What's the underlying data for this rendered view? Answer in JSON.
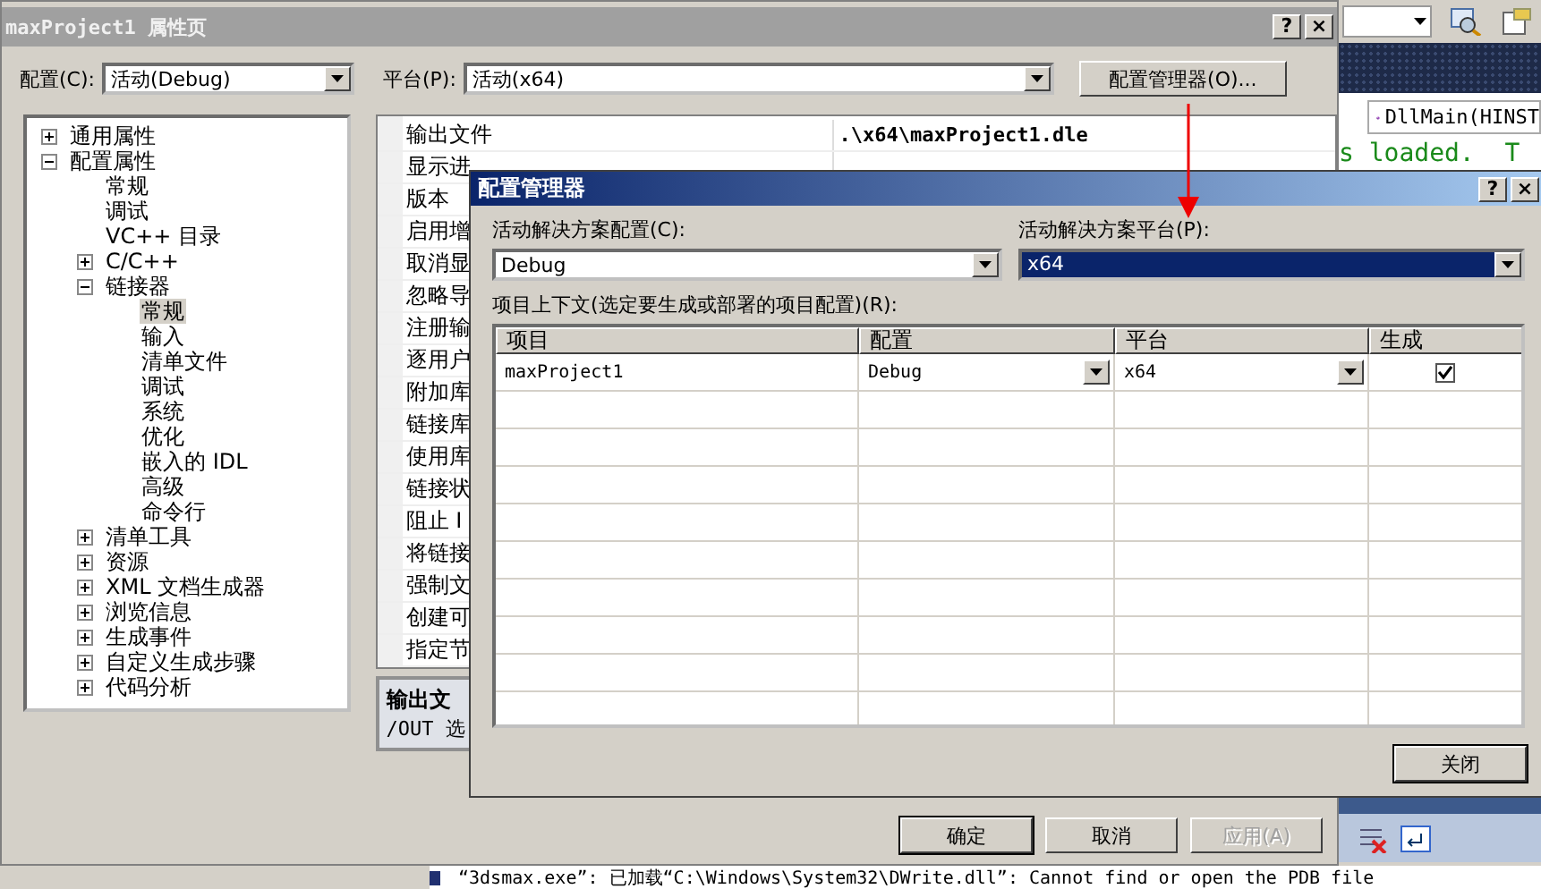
{
  "ide": {
    "function_combo": "DllMain(HINST",
    "code_snippet": "s loaded.  T",
    "output_line": "“3dsmax.exe”: 已加载“C:\\Windows\\System32\\DWrite.dll”: Cannot find or open the PDB file"
  },
  "property_window": {
    "title": "maxProject1 属性页",
    "help": "?",
    "close": "×",
    "config_label": "配置(C):",
    "config_value": "活动(Debug)",
    "platform_label": "平台(P):",
    "platform_value": "活动(x64)",
    "manager_button": "配置管理器(O)...",
    "tree": [
      {
        "label": "通用属性",
        "expanded": false,
        "selected": false
      },
      {
        "label": "配置属性",
        "expanded": true,
        "selected": false,
        "children": [
          {
            "label": "常规",
            "selected": false
          },
          {
            "label": "调试",
            "selected": false
          },
          {
            "label": "VC++ 目录",
            "selected": false
          },
          {
            "label": "C/C++",
            "expanded": false,
            "selected": false
          },
          {
            "label": "链接器",
            "expanded": true,
            "selected": false,
            "children": [
              {
                "label": "常规",
                "selected": true
              },
              {
                "label": "输入",
                "selected": false
              },
              {
                "label": "清单文件",
                "selected": false
              },
              {
                "label": "调试",
                "selected": false
              },
              {
                "label": "系统",
                "selected": false
              },
              {
                "label": "优化",
                "selected": false
              },
              {
                "label": "嵌入的 IDL",
                "selected": false
              },
              {
                "label": "高级",
                "selected": false
              },
              {
                "label": "命令行",
                "selected": false
              }
            ]
          },
          {
            "label": "清单工具",
            "expanded": false,
            "selected": false
          },
          {
            "label": "资源",
            "expanded": false,
            "selected": false
          },
          {
            "label": "XML 文档生成器",
            "expanded": false,
            "selected": false
          },
          {
            "label": "浏览信息",
            "expanded": false,
            "selected": false
          },
          {
            "label": "生成事件",
            "expanded": false,
            "selected": false
          },
          {
            "label": "自定义生成步骤",
            "expanded": false,
            "selected": false
          },
          {
            "label": "代码分析",
            "expanded": false,
            "selected": false
          }
        ]
      }
    ],
    "properties": [
      {
        "name": "输出文件",
        "value": ".\\x64\\maxProject1.dle"
      },
      {
        "name": "显示进"
      },
      {
        "name": "版本"
      },
      {
        "name": "启用增"
      },
      {
        "name": "取消显"
      },
      {
        "name": "忽略导"
      },
      {
        "name": "注册输"
      },
      {
        "name": "逐用户"
      },
      {
        "name": "附加库"
      },
      {
        "name": "链接库"
      },
      {
        "name": "使用库"
      },
      {
        "name": "链接状"
      },
      {
        "name": "阻止 I"
      },
      {
        "name": "将链接"
      },
      {
        "name": "强制文"
      },
      {
        "name": "创建可"
      },
      {
        "name": "指定节"
      }
    ],
    "description": {
      "title": "输出文",
      "text": "/OUT 选"
    },
    "buttons": [
      {
        "label": "确定",
        "disabled": false,
        "default": true
      },
      {
        "label": "取消",
        "disabled": false,
        "default": false
      },
      {
        "label": "应用(A)",
        "disabled": true,
        "default": false
      }
    ]
  },
  "config_manager": {
    "title": "配置管理器",
    "help": "?",
    "close": "×",
    "solution_config_label": "活动解决方案配置(C):",
    "solution_config": {
      "value": "Debug",
      "selected": false
    },
    "solution_platform_label": "活动解决方案平台(P):",
    "solution_platform": {
      "value": "x64",
      "selected": true
    },
    "context_label": "项目上下文(选定要生成或部署的项目配置)(R):",
    "columns": [
      "项目",
      "配置",
      "平台",
      "生成"
    ],
    "rows": [
      {
        "project": "maxProject1",
        "config": "Debug",
        "platform": "x64",
        "build": true
      }
    ],
    "close_button": "关闭"
  }
}
